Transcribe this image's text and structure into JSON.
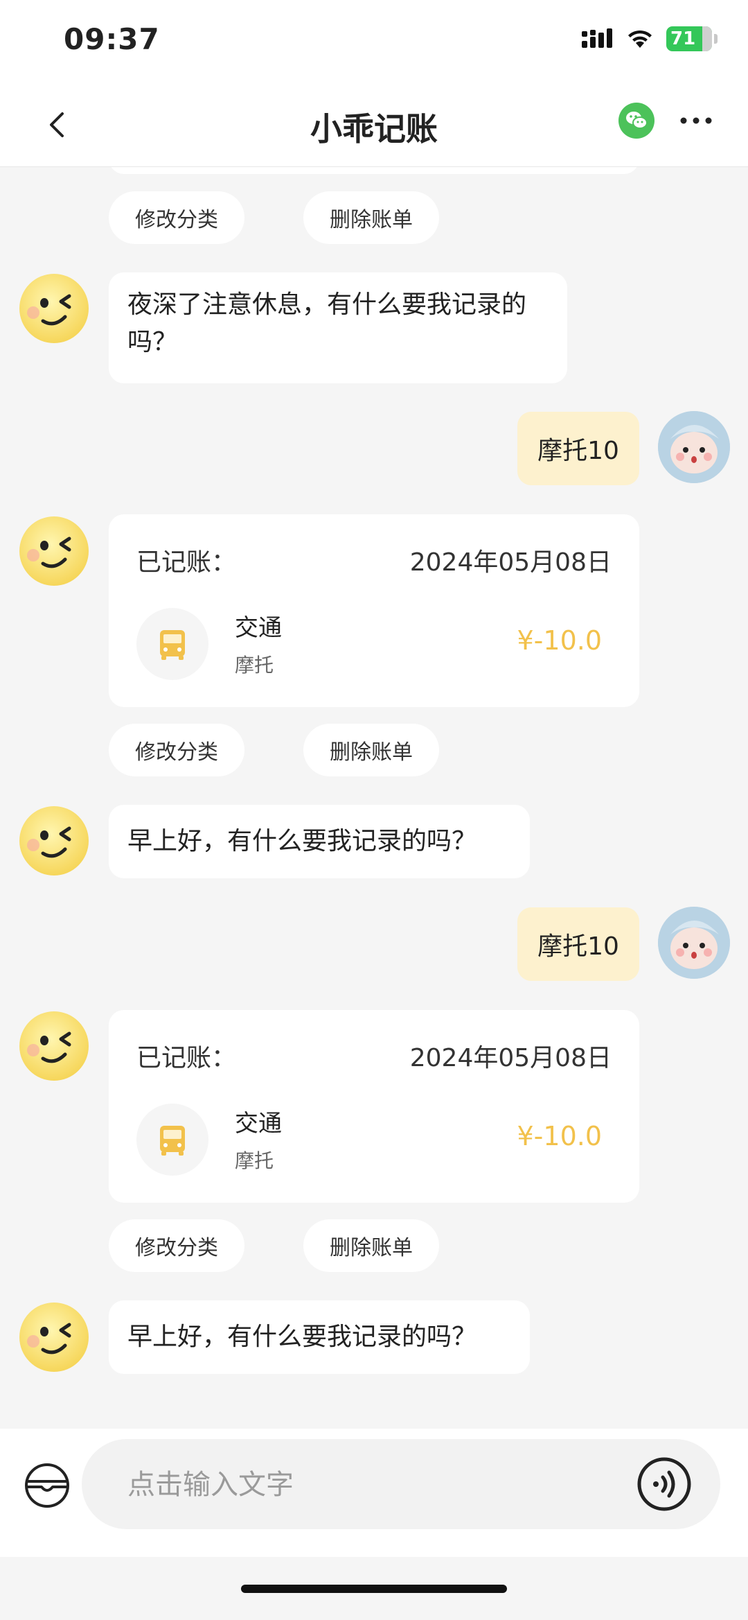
{
  "status_bar": {
    "time": "09:37",
    "battery": "71"
  },
  "nav": {
    "title": "小乖记账"
  },
  "messages": {
    "top_actions": {
      "edit": "修改分类",
      "delete": "删除账单"
    },
    "bot_greeting_1": "夜深了注意休息，有什么要我记录的吗？",
    "user_msg_1": "摩托10",
    "record_1": {
      "label": "已记账：",
      "date": "2024年05月08日",
      "category": "交通",
      "note": "摩托",
      "amount": "¥-10.0",
      "edit": "修改分类",
      "delete": "删除账单"
    },
    "bot_greeting_2": "早上好，有什么要我记录的吗？",
    "user_msg_2": "摩托10",
    "record_2": {
      "label": "已记账：",
      "date": "2024年05月08日",
      "category": "交通",
      "note": "摩托",
      "amount": "¥-10.0",
      "edit": "修改分类",
      "delete": "删除账单"
    },
    "bot_greeting_3": "早上好，有什么要我记录的吗？"
  },
  "input": {
    "placeholder": "点击输入文字"
  },
  "colors": {
    "accent": "#f2c14b",
    "user_bubble": "#fdf1ce",
    "wechat_green": "#4cc25a"
  }
}
